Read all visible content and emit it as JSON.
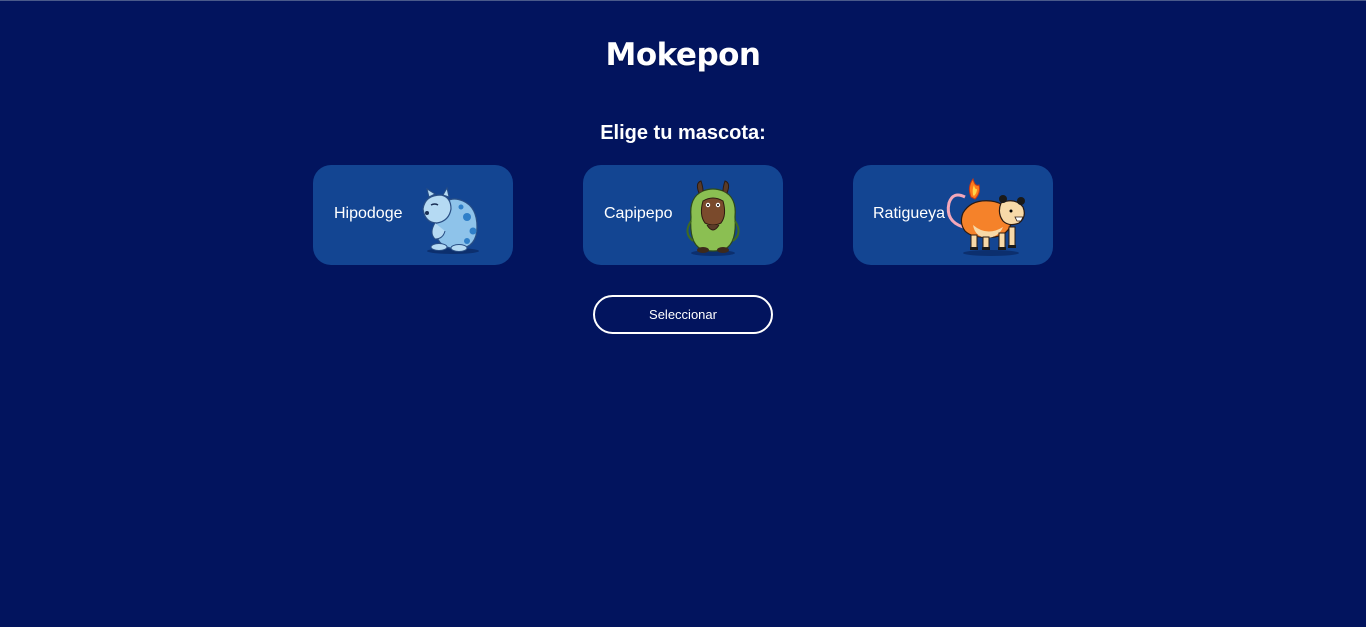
{
  "app": {
    "title": "Mokepon",
    "subtitle": "Elige tu mascota:"
  },
  "pets": [
    {
      "name": "Hipodoge",
      "icon": "hipodoge-icon"
    },
    {
      "name": "Capipepo",
      "icon": "capipepo-icon"
    },
    {
      "name": "Ratigueya",
      "icon": "ratigueya-icon"
    }
  ],
  "actions": {
    "select_label": "Seleccionar"
  },
  "colors": {
    "background": "#02145e",
    "card": "#134592",
    "text": "#ffffff"
  }
}
